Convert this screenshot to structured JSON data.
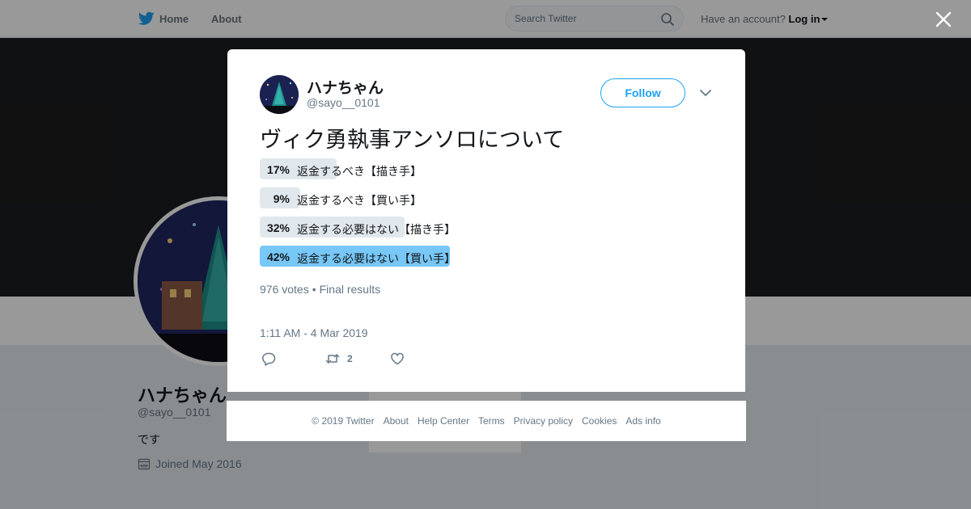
{
  "topbar": {
    "home_label": "Home",
    "about_label": "About",
    "search_placeholder": "Search Twitter",
    "have_account": "Have an account?",
    "login_label": "Log in"
  },
  "profile": {
    "name": "ハナちゃん",
    "handle": "@sayo__0101",
    "bio": "です",
    "joined": "Joined May 2016"
  },
  "tweet": {
    "author_name": "ハナちゃん",
    "author_handle": "@sayo__0101",
    "follow_label": "Follow",
    "text": "ヴィク勇執事アンソロについて",
    "poll": {
      "choices": [
        {
          "percent": "17%",
          "fraction": 0.17,
          "label": "返金するべき【描き手】",
          "winner": false
        },
        {
          "percent": "9%",
          "fraction": 0.09,
          "label": "返金するべき【買い手】",
          "winner": false
        },
        {
          "percent": "32%",
          "fraction": 0.32,
          "label": "返金する必要はない【描き手】",
          "winner": false
        },
        {
          "percent": "42%",
          "fraction": 0.42,
          "label": "返金する必要はない【買い手】",
          "winner": true
        }
      ],
      "votes": "976 votes",
      "separator": "•",
      "status": "Final results"
    },
    "timestamp": "1:11 AM - 4 Mar 2019",
    "retweet_count": "2"
  },
  "footer": {
    "links": [
      "© 2019 Twitter",
      "About",
      "Help Center",
      "Terms",
      "Privacy policy",
      "Cookies",
      "Ads info"
    ]
  },
  "colors": {
    "accent": "#1da1f2",
    "poll_bar": "#e1e8ed",
    "poll_winner": "#77c7f7"
  },
  "icons": [
    "twitter-logo-icon",
    "search-icon",
    "close-icon",
    "chevron-down-icon",
    "calendar-icon",
    "reply-icon",
    "retweet-icon",
    "like-icon"
  ]
}
